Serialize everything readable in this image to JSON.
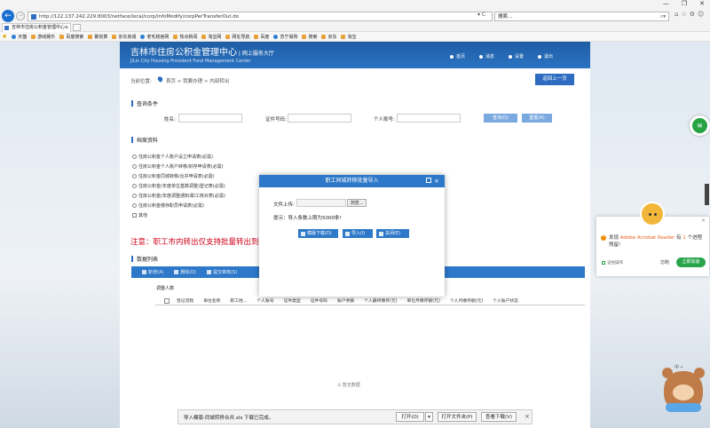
{
  "browser": {
    "url": "http://122.137.242.229:8003/netface/local/corp/InfoModify/corpPerTransferOut.do",
    "search_placeholder": "搜索...",
    "tab_title": "吉林市住房公积金管理中心...",
    "window_controls": [
      "—",
      "❐",
      "✕"
    ],
    "favorites": [
      "天猫",
      "游戏娱乐",
      "百度搜索",
      "聚划算",
      "京东商城",
      "老毛桃官网",
      "热点新闻",
      "淘宝网",
      "网址导航",
      "百度",
      "苏宁易购",
      "搜索",
      "京东",
      "淘宝"
    ]
  },
  "header": {
    "org_name_cn": "吉林市住房公积金管理中心",
    "org_name_suffix": "网上服务大厅",
    "org_name_en": "JiLin City Housing Provident Fund Management Center",
    "nav": [
      "首页",
      "消息",
      "设置",
      "退出"
    ]
  },
  "breadcrumb": {
    "label": "当前位置:",
    "path": "首页 > 我要办理 > 内部转出"
  },
  "return_button": "返回上一页",
  "query": {
    "title": "查询条件",
    "name_label": "姓名:",
    "id_label": "证件号码:",
    "account_label": "个人账号:",
    "query_button": "查询(Q)",
    "reset_button": "重置(R)"
  },
  "material": {
    "title": "档案资料",
    "items": [
      "住房公积金个人账户设立申请表(必需)",
      "住房公积金个人账户转移/封存申请表(必需)",
      "住房公积金同城转移/合并申请表(必需)",
      "住房公积金(年度单位基数调整)登记表(必需)",
      "住房公积金(年度调整通知)职工核对表(必需)",
      "住房公积金缴存职员申请表(必需)",
      "其他"
    ]
  },
  "notice": "注意：职工市内转出仅支持批量转出到同一个单位",
  "datalist": {
    "title": "数据列表",
    "toolbar": [
      "新增(A)",
      "删除(D)",
      "提交审核(S)"
    ],
    "upload_header": "调整人数",
    "columns": [
      "登记流程",
      "单位名称",
      "职工姓...",
      "个人账号",
      "证件类型",
      "证件号码",
      "账户余额",
      "个人最终缴存(元)",
      "单位月缴存额(元)",
      "个人月缴存额(元)",
      "个人账户状态"
    ],
    "empty_text": "暂无数据"
  },
  "modal": {
    "title": "职工同城转移批量导入",
    "file_label": "文件上传:",
    "browse_button": "浏览...",
    "tip": "提示：导入条数上限为5000条!",
    "buttons": [
      "模版下载(D)",
      "导入(I)",
      "关闭(E)"
    ]
  },
  "download_bar": {
    "message": "导入模版-同城转移合并.xls 下载已完成。",
    "open": "打开(O)",
    "open_folder": "打开文件夹(P)",
    "view_downloads": "查看下载(V)",
    "close": "×"
  },
  "acrobat_popup": {
    "message_prefix": "发现",
    "app_name": "Adobe Acrobat Reader",
    "message_mid": "有",
    "count": "1",
    "message_suffix": "个进程残留!",
    "remember": "记住操作",
    "ignore": "忽略",
    "action": "立即加速",
    "close": "×"
  },
  "bear_tag": "中 •"
}
